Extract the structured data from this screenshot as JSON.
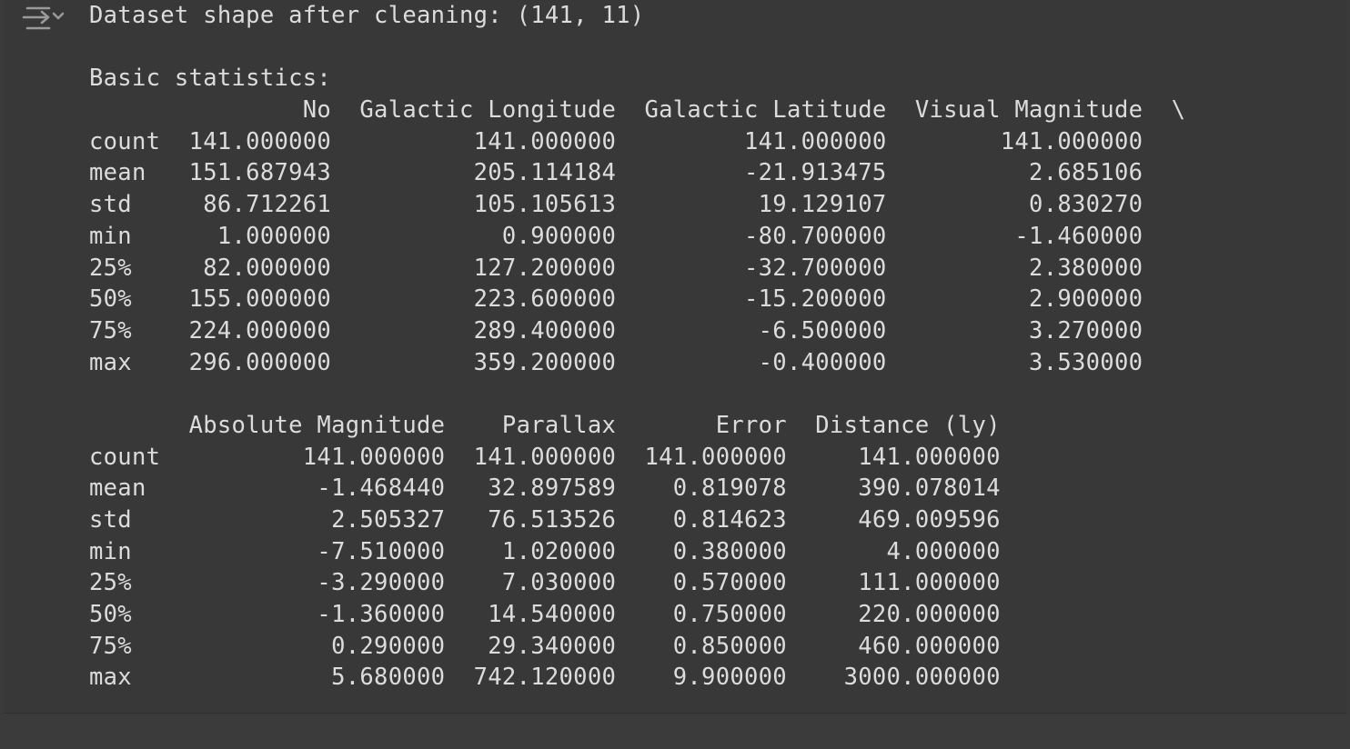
{
  "output": {
    "icon": "output-collapse-icon",
    "lines": [
      "Dataset shape after cleaning: (141, 11)",
      "",
      "Basic statistics:",
      "               No  Galactic Longitude  Galactic Latitude  Visual Magnitude  \\",
      "count  141.000000          141.000000         141.000000        141.000000   ",
      "mean   151.687943          205.114184         -21.913475          2.685106   ",
      "std     86.712261          105.105613          19.129107          0.830270   ",
      "min      1.000000            0.900000         -80.700000         -1.460000   ",
      "25%     82.000000          127.200000         -32.700000          2.380000   ",
      "50%    155.000000          223.600000         -15.200000          2.900000   ",
      "75%    224.000000          289.400000          -6.500000          3.270000   ",
      "max    296.000000          359.200000          -0.400000          3.530000   ",
      "",
      "       Absolute Magnitude    Parallax       Error  Distance (ly)  ",
      "count          141.000000  141.000000  141.000000     141.000000  ",
      "mean            -1.468440   32.897589    0.819078     390.078014  ",
      "std              2.505327   76.513526    0.814623     469.009596  ",
      "min             -7.510000    1.020000    0.380000       4.000000  ",
      "25%             -3.290000    7.030000    0.570000     111.000000  ",
      "50%             -1.360000   14.540000    0.750000     220.000000  ",
      "75%              0.290000   29.340000    0.850000     460.000000  ",
      "max              5.680000  742.120000    9.900000    3000.000000  "
    ]
  }
}
